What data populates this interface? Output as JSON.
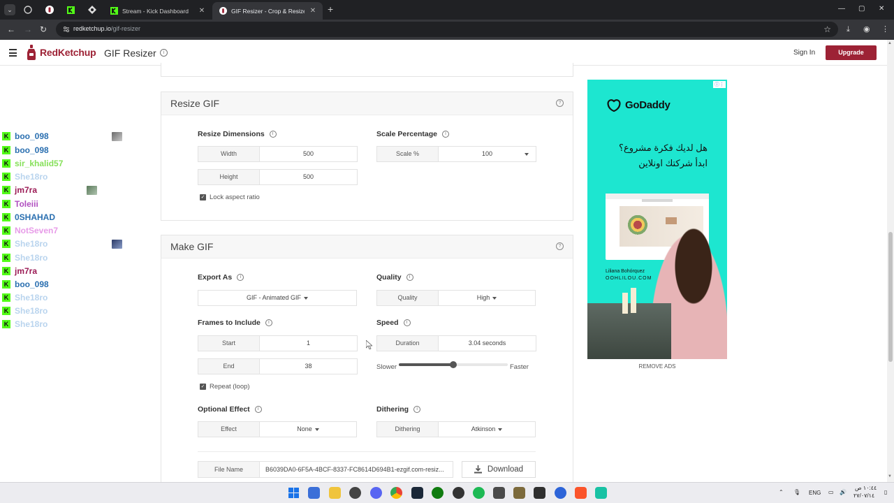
{
  "browser": {
    "tabs": [
      {
        "title": "Stream - Kick Dashboard",
        "close": "✕"
      },
      {
        "title": "GIF Resizer - Crop & Resize Animated",
        "close": "✕"
      }
    ],
    "new_tab": "+",
    "url_host": "redketchup.io",
    "url_path": "/gif-resizer",
    "window_controls": {
      "minimize": "—",
      "maximize": "▢",
      "close": "✕"
    }
  },
  "header": {
    "logo_text": "RedKetchup",
    "page_title": "GIF Resizer",
    "signin": "Sign In",
    "upgrade": "Upgrade"
  },
  "chat": [
    {
      "user": "boo_098",
      "color": "#2a6fb0",
      "emote": true
    },
    {
      "user": "boo_098",
      "color": "#2a6fb0",
      "emote": false
    },
    {
      "user": "sir_khalid57",
      "color": "#86e05a",
      "emote": false
    },
    {
      "user": "She18ro",
      "color": "#b9d4ee",
      "emote": false
    },
    {
      "user": "jm7ra",
      "color": "#9b1b55",
      "emote": true
    },
    {
      "user": "Toleiii",
      "color": "#b04fc0",
      "emote": false
    },
    {
      "user": "0SHAHAD",
      "color": "#2a6fb0",
      "emote": false
    },
    {
      "user": "NotSeven7",
      "color": "#e79be8",
      "emote": false
    },
    {
      "user": "She18ro",
      "color": "#b9d4ee",
      "emote": true
    },
    {
      "user": "She18ro",
      "color": "#b9d4ee",
      "emote": false
    },
    {
      "user": "jm7ra",
      "color": "#9b1b55",
      "emote": false
    },
    {
      "user": "boo_098",
      "color": "#2a6fb0",
      "emote": false
    },
    {
      "user": "She18ro",
      "color": "#b9d4ee",
      "emote": false
    },
    {
      "user": "She18ro",
      "color": "#b9d4ee",
      "emote": false
    },
    {
      "user": "She18ro",
      "color": "#b9d4ee",
      "emote": false
    }
  ],
  "resize": {
    "title": "Resize GIF",
    "dimensions_label": "Resize Dimensions",
    "width_label": "Width",
    "width_value": "500",
    "height_label": "Height",
    "height_value": "500",
    "lock_aspect": "Lock aspect ratio",
    "scale_label": "Scale Percentage",
    "scale_field": "Scale %",
    "scale_value": "100"
  },
  "make": {
    "title": "Make GIF",
    "export_label": "Export As",
    "export_value": "GIF - Animated GIF",
    "quality_label": "Quality",
    "quality_field": "Quality",
    "quality_value": "High",
    "frames_label": "Frames to Include",
    "start_label": "Start",
    "start_value": "1",
    "end_label": "End",
    "end_value": "38",
    "repeat": "Repeat (loop)",
    "speed_label": "Speed",
    "duration_label": "Duration",
    "duration_value": "3.04 seconds",
    "slower": "Slower",
    "faster": "Faster",
    "speed_slider_value": 0.5,
    "effect_label": "Optional Effect",
    "effect_field": "Effect",
    "effect_value": "None",
    "dither_label": "Dithering",
    "dither_field": "Dithering",
    "dither_value": "Atkinson",
    "filename_label": "File Name",
    "filename_value": "B6039DA0-6F5A-4BCF-8337-FC8614D694B1-ezgif.com-resiz...",
    "download": "Download"
  },
  "ad": {
    "brand": "GoDaddy",
    "arabic_line1": "هل لديك فكرة مشروع؟",
    "arabic_line2": "ابدأ شركتك اونلاين",
    "caption_name": "Liliana Bohórquez",
    "caption_site": "OOHLILOU.COM",
    "remove_ads": "REMOVE ADS"
  },
  "taskbar": {
    "lang": "ENG",
    "time": "١٠:٤٤ ص",
    "date": "٢٧/٠٧/١٤"
  }
}
